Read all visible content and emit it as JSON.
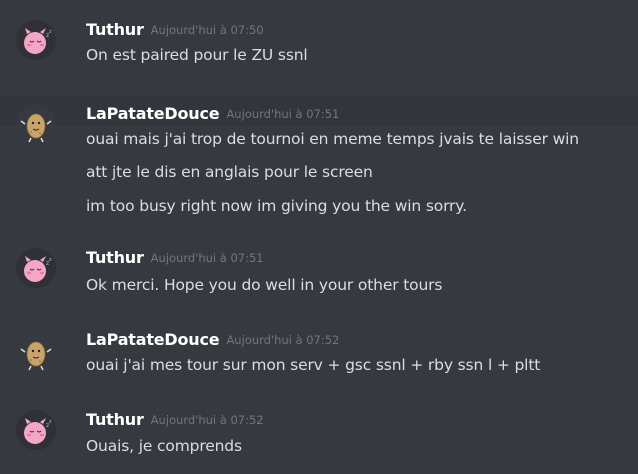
{
  "messages": [
    {
      "author": "Tuthur",
      "time": "Aujourd'hui à 07:50",
      "lines": [
        "On est paired pour le ZU ssnl"
      ]
    },
    {
      "author": "LaPatateDouce",
      "time": "Aujourd'hui à 07:51",
      "lines": [
        "ouai mais j'ai trop de tournoi en meme temps jvais te laisser win",
        "att jte le dis en anglais pour le screen",
        "im too busy right now im giving you the win sorry."
      ]
    },
    {
      "author": "Tuthur",
      "time": "Aujourd'hui à 07:51",
      "lines": [
        "Ok merci. Hope you do well in your other tours"
      ]
    },
    {
      "author": "LaPatateDouce",
      "time": "Aujourd'hui à 07:52",
      "lines": [
        "ouai j'ai mes tour sur mon serv + gsc ssnl + rby ssn l + pltt"
      ]
    },
    {
      "author": "Tuthur",
      "time": "Aujourd'hui à 07:52",
      "lines": [
        "Ouais, je comprends"
      ]
    }
  ],
  "colors": {
    "background": "#36393f",
    "username": "#ffffff",
    "message_text": "#dcddde",
    "timestamp": "#72767d"
  },
  "icons": {
    "tuthur_avatar": "jigglypuff-avatar-icon",
    "patate_avatar": "potato-avatar-icon"
  }
}
